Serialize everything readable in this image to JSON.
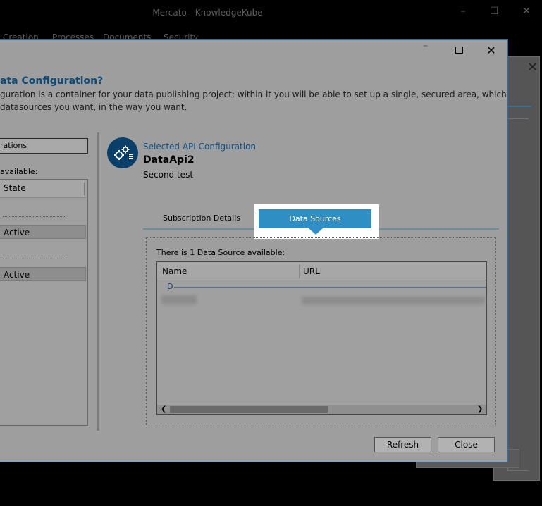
{
  "app": {
    "title": "Mercato - KnowledgeKube",
    "menu": [
      "Creation",
      "Processes",
      "Documents",
      "Security"
    ]
  },
  "window_controls": {
    "minimize": "–",
    "maximize": "☐",
    "close": "✕"
  },
  "dialog": {
    "info_title": "ata Configuration?",
    "info_line1": "guration is a container for your data publishing project; within it you will be able to set up a single, secured area, which",
    "info_line2": " datasources you want, in the way you want.",
    "left_filter_value": "rations",
    "left_available_label": " available:",
    "left_list": {
      "column_state": "State",
      "rows": [
        {
          "state": "Active"
        },
        {
          "state": "Active"
        }
      ]
    },
    "selected": {
      "label": "Selected API Configuration",
      "name": "DataApi2",
      "description": "Second test",
      "icon": "gears-icon"
    },
    "tabs": [
      {
        "label": "Subscription Details",
        "active": false
      },
      {
        "label": "Data Sources",
        "active": true
      }
    ],
    "data_sources": {
      "count_label": "There is 1 Data Source available:",
      "columns": [
        "Name",
        "URL"
      ],
      "group": "D"
    },
    "buttons": {
      "refresh": "Refresh",
      "close": "Close"
    }
  },
  "colors": {
    "accent": "#2f8fc4",
    "link": "#0d4f86",
    "dialog_border": "#2f6cae"
  }
}
